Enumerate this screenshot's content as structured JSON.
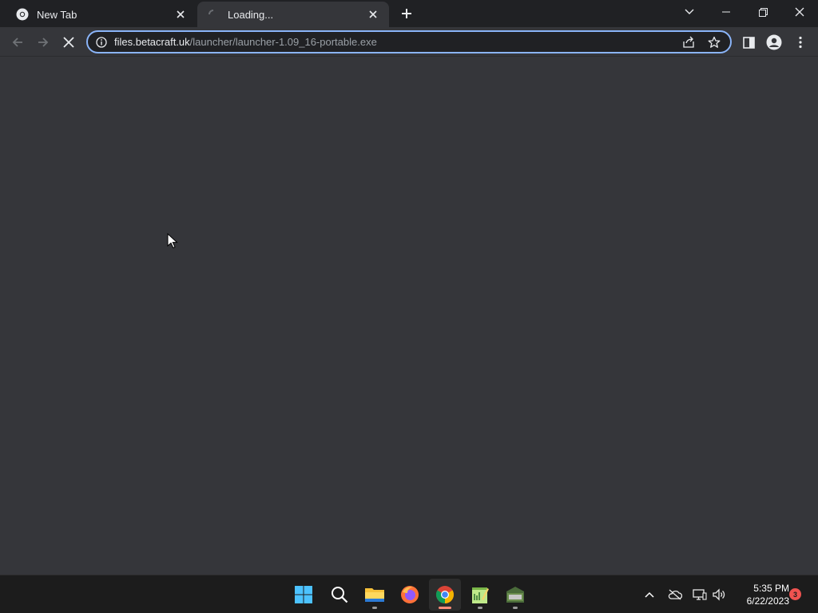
{
  "tabs": [
    {
      "title": "New Tab",
      "favicon": "chrome-icon",
      "active": false
    },
    {
      "title": "Loading...",
      "favicon": "loading-spinner-icon",
      "active": true
    }
  ],
  "toolbar": {
    "url_host": "files.betacraft.uk",
    "url_path": "/launcher/launcher-1.09_16-portable.exe"
  },
  "taskbar": {
    "apps": [
      {
        "name": "start",
        "icon": "windows-start-icon"
      },
      {
        "name": "search",
        "icon": "search-icon"
      },
      {
        "name": "file-explorer",
        "icon": "folder-icon"
      },
      {
        "name": "firefox",
        "icon": "firefox-icon"
      },
      {
        "name": "chrome",
        "icon": "chrome-icon",
        "active": true
      },
      {
        "name": "notepad-plus",
        "icon": "notepad-icon"
      },
      {
        "name": "betacraft",
        "icon": "betacraft-icon"
      }
    ],
    "clock_time": "5:35 PM",
    "clock_date": "6/22/2023",
    "notification_count": "3"
  },
  "colors": {
    "accent": "#8ab4f8",
    "tab_strip": "#202124",
    "toolbar": "#35363a",
    "taskbar": "#1c1c1c"
  }
}
